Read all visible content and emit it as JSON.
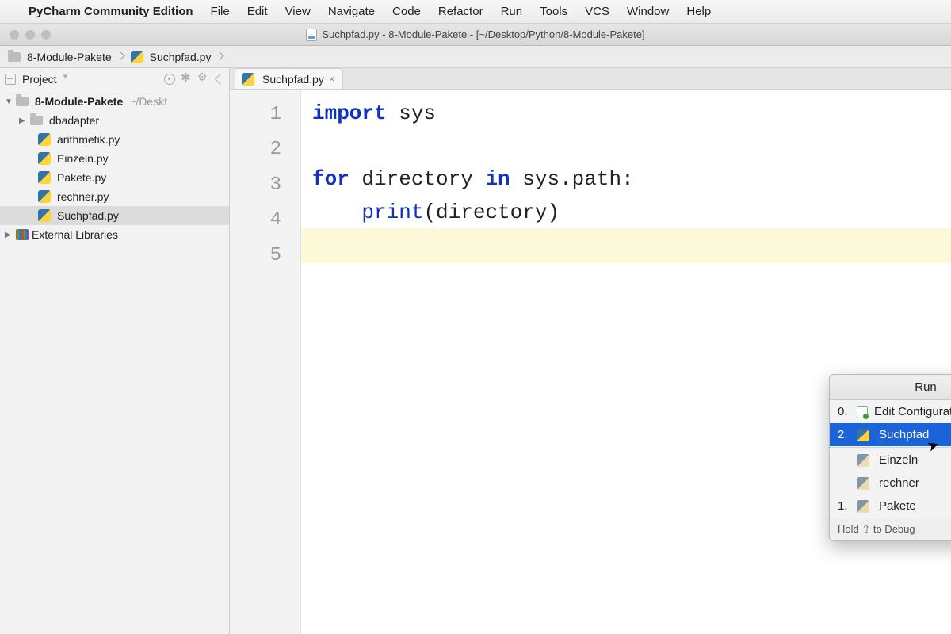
{
  "mac_menu": {
    "app_name": "PyCharm Community Edition",
    "items": [
      "File",
      "Edit",
      "View",
      "Navigate",
      "Code",
      "Refactor",
      "Run",
      "Tools",
      "VCS",
      "Window",
      "Help"
    ]
  },
  "window_title": "Suchpfad.py - 8-Module-Pakete - [~/Desktop/Python/8-Module-Pakete]",
  "breadcrumb": {
    "root": "8-Module-Pakete",
    "file": "Suchpfad.py"
  },
  "project_panel": {
    "title": "Project",
    "root": "8-Module-Pakete",
    "root_path": "~/Deskt",
    "folder": "dbadapter",
    "files": [
      "arithmetik.py",
      "Einzeln.py",
      "Pakete.py",
      "rechner.py",
      "Suchpfad.py"
    ],
    "external": "External Libraries"
  },
  "editor": {
    "tab": "Suchpfad.py",
    "lines": [
      "1",
      "2",
      "3",
      "4",
      "5"
    ],
    "code": {
      "l1a": "import",
      "l1b": " sys",
      "l3a": "for",
      "l3b": " directory ",
      "l3c": "in",
      "l3d": " sys.path:",
      "l4a": "    ",
      "l4b": "print",
      "l4c": "(directory)"
    }
  },
  "run_popup": {
    "title": "Run",
    "items": [
      {
        "num": "0.",
        "label": "Edit Configurations...",
        "kind": "edit"
      },
      {
        "num": "2.",
        "label": "Suchpfad",
        "kind": "py",
        "selected": true,
        "arrow": true
      },
      {
        "num": "",
        "label": "Einzeln",
        "kind": "py-dim",
        "arrow": true
      },
      {
        "num": "",
        "label": "rechner",
        "kind": "py-dim",
        "arrow": true
      },
      {
        "num": "1.",
        "label": "Pakete",
        "kind": "py-dim",
        "arrow": true
      }
    ],
    "footer": "Hold ⇧ to Debug"
  }
}
